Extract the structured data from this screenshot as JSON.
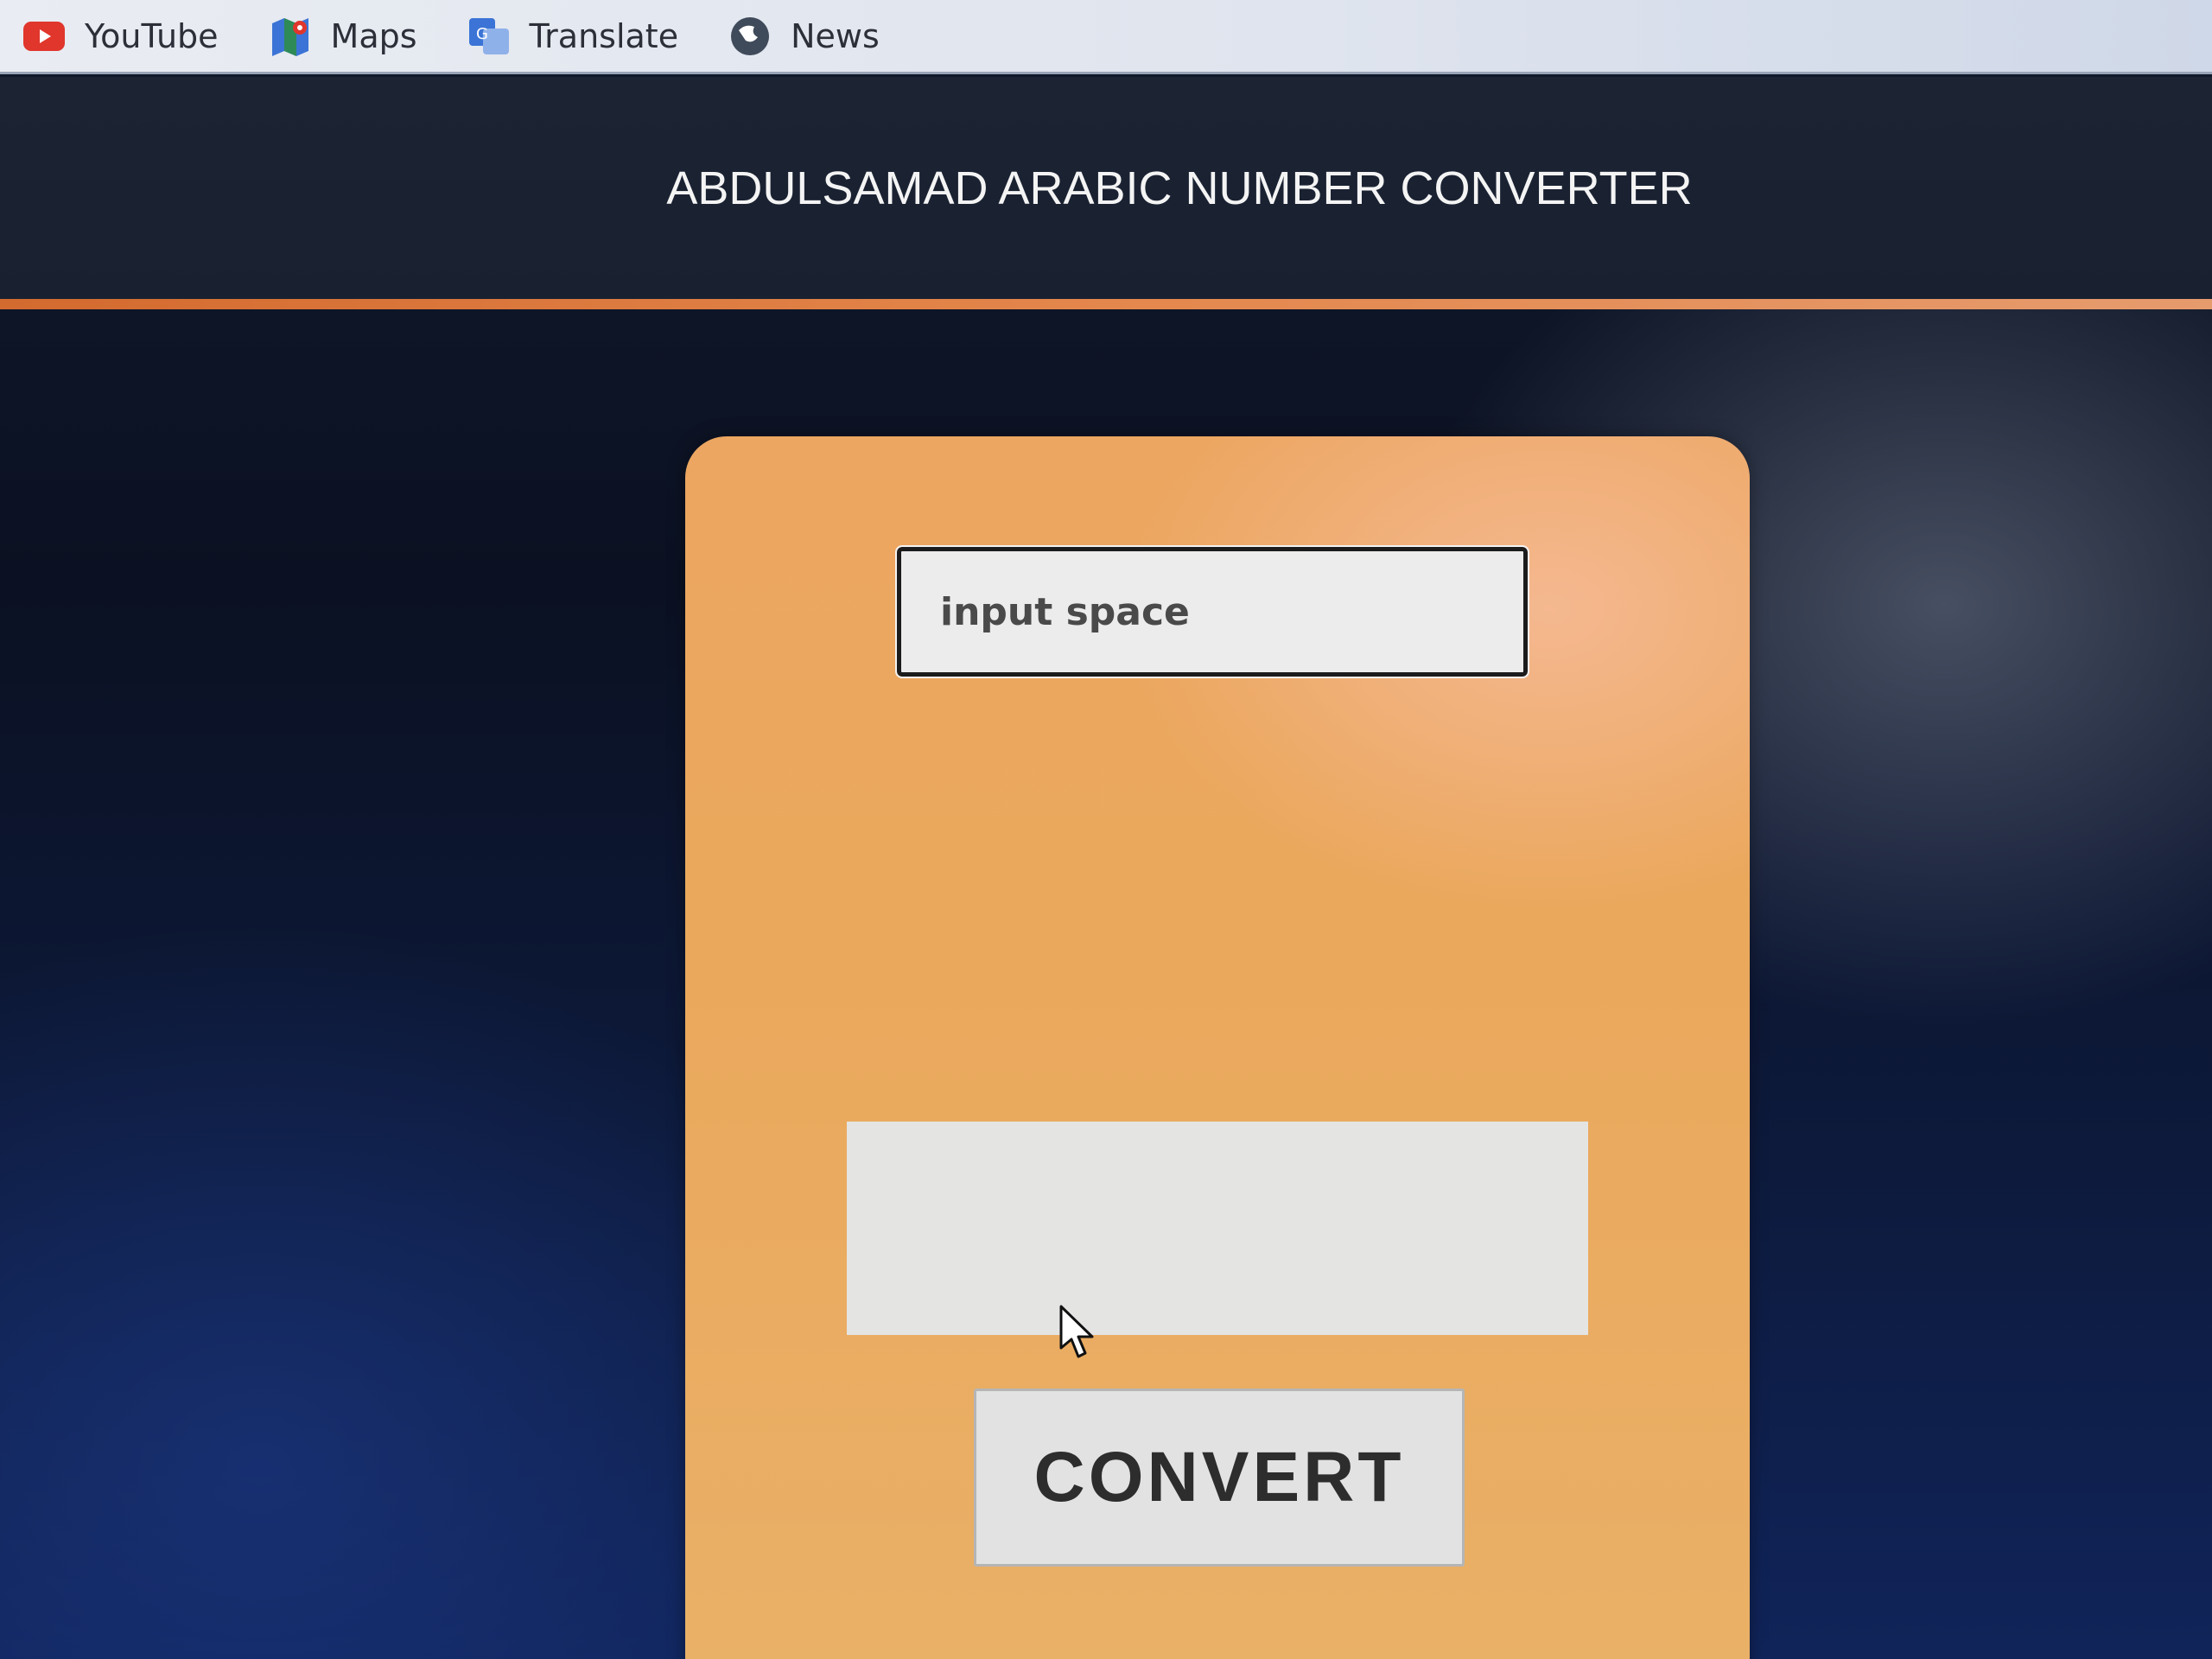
{
  "bookmarks": [
    {
      "label": "YouTube",
      "icon": "youtube-icon"
    },
    {
      "label": "Maps",
      "icon": "maps-icon"
    },
    {
      "label": "Translate",
      "icon": "translate-icon"
    },
    {
      "label": "News",
      "icon": "news-icon"
    }
  ],
  "header": {
    "title": "ABDULSAMAD ARABIC NUMBER CONVERTER"
  },
  "form": {
    "input_value": "",
    "input_placeholder": "input space",
    "output_text": "",
    "convert_label": "CONVERT"
  },
  "colors": {
    "header_bg": "#1c2434",
    "accent_line": "#e4874c",
    "card_bg": "#eaa85c",
    "field_bg": "#ececed",
    "button_bg": "#e2e2e2",
    "youtube_red": "#e0362c",
    "maps_green": "#2e8b57",
    "translate_blue": "#3b74d6",
    "news_gray": "#3f4a5a"
  }
}
